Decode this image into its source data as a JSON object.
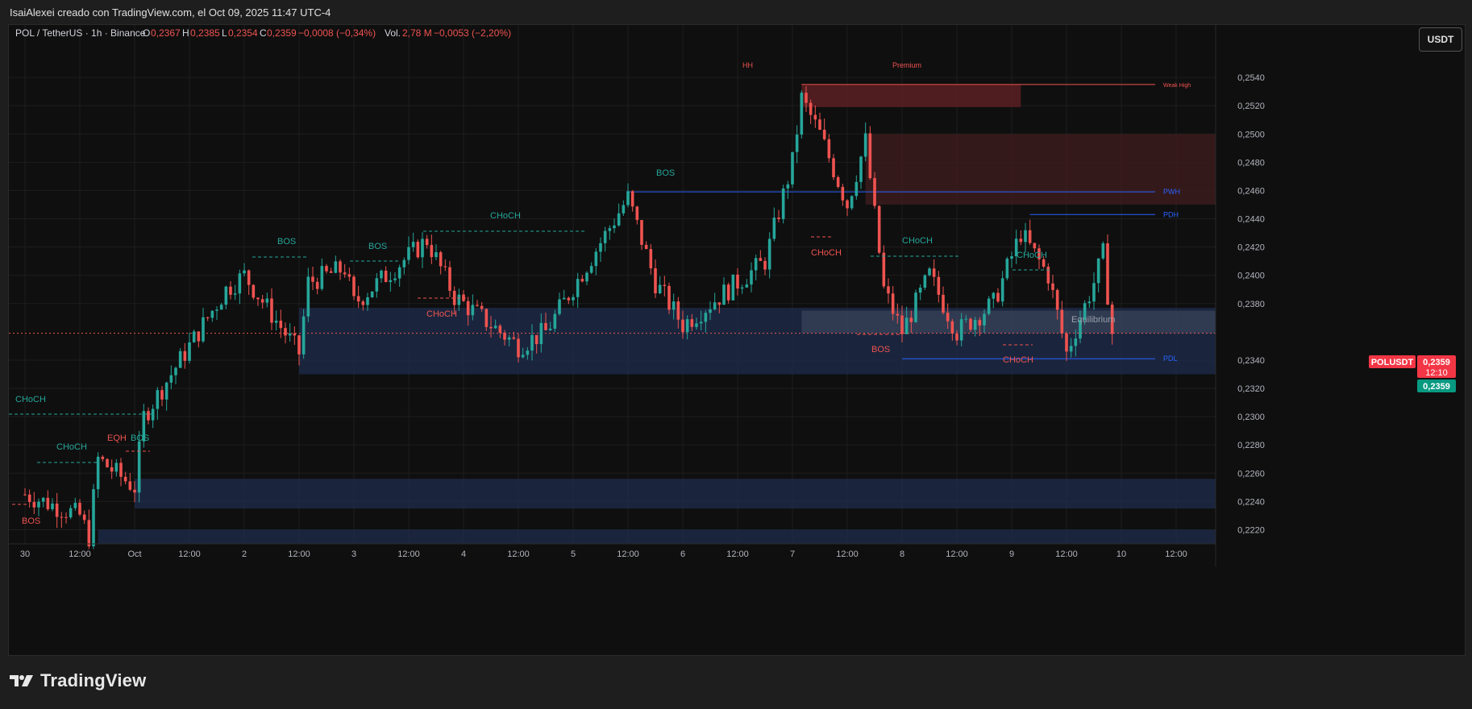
{
  "header": {
    "attribution": "IsaiAlexei creado con TradingView.com, el Oct 09, 2025 11:47 UTC-4"
  },
  "legend": {
    "symbol": "POL / TetherUS · 1h · Binance",
    "o_label": "O",
    "o_value": "0,2367",
    "h_label": "H",
    "h_value": "0,2385",
    "l_label": "L",
    "l_value": "0,2354",
    "c_label": "C",
    "c_value": "0,2359",
    "change": "−0,0008 (−0,34%)",
    "vol_label": "Vol.",
    "vol_value": "2,78 M",
    "vol_change": "−0,0053 (−2,20%)"
  },
  "currency_button": "USDT",
  "price_badges": {
    "symbol_tag": "POLUSDT",
    "last_price": "0,2359",
    "countdown": "12:10",
    "bid_price": "0,2359"
  },
  "colors": {
    "up": "#26a69a",
    "down": "#ef5350",
    "background": "#0f0f0f",
    "grid": "#1e1e1e",
    "demand_zone": "#1f2e4d",
    "premium_zone": "#5a1f22"
  },
  "chart_data": {
    "type": "candlestick",
    "title": "",
    "y_axis": {
      "side": "right",
      "ylim": [
        0.221,
        0.256
      ],
      "ticks": [
        "0,2540",
        "0,2520",
        "0,2500",
        "0,2480",
        "0,2460",
        "0,2440",
        "0,2420",
        "0,2400",
        "0,2380",
        "0,2340",
        "0,2320",
        "0,2300",
        "0,2280",
        "0,2260",
        "0,2240",
        "0,2220"
      ]
    },
    "x_axis": {
      "ticks": [
        "30",
        "12:00",
        "Oct",
        "12:00",
        "2",
        "12:00",
        "3",
        "12:00",
        "4",
        "12:00",
        "5",
        "12:00",
        "6",
        "12:00",
        "7",
        "12:00",
        "8",
        "12:00",
        "9",
        "12:00",
        "10",
        "12:00"
      ]
    },
    "grid": true,
    "current_price": 0.2359,
    "ohlc_anchor_points": [
      {
        "time": "Sep 30 00:00",
        "close": 0.2245
      },
      {
        "time": "Sep 30 12:00",
        "close": 0.223
      },
      {
        "time": "Sep 30 14:00",
        "close": 0.2215
      },
      {
        "time": "Sep 30 16:00",
        "close": 0.227
      },
      {
        "time": "Oct 1 00:00",
        "close": 0.225
      },
      {
        "time": "Oct 1 02:00",
        "close": 0.23
      },
      {
        "time": "Oct 1 12:00",
        "close": 0.235
      },
      {
        "time": "Oct 1 20:00",
        "close": 0.239
      },
      {
        "time": "Oct 2 00:00",
        "close": 0.24
      },
      {
        "time": "Oct 2 12:00",
        "close": 0.2345
      },
      {
        "time": "Oct 2 14:00",
        "close": 0.2395
      },
      {
        "time": "Oct 2 22:00",
        "close": 0.2405
      },
      {
        "time": "Oct 3 00:00",
        "close": 0.238
      },
      {
        "time": "Oct 3 16:00",
        "close": 0.2425
      },
      {
        "time": "Oct 3 22:00",
        "close": 0.2385
      },
      {
        "time": "Oct 4 12:00",
        "close": 0.235
      },
      {
        "time": "Oct 4 18:00",
        "close": 0.236
      },
      {
        "time": "Oct 5 12:00",
        "close": 0.2455
      },
      {
        "time": "Oct 5 18:00",
        "close": 0.2395
      },
      {
        "time": "Oct 6 00:00",
        "close": 0.2365
      },
      {
        "time": "Oct 6 18:00",
        "close": 0.241
      },
      {
        "time": "Oct 7 00:00",
        "close": 0.248
      },
      {
        "time": "Oct 7 02:00",
        "close": 0.2525
      },
      {
        "time": "Oct 7 06:00",
        "close": 0.25
      },
      {
        "time": "Oct 7 12:00",
        "close": 0.245
      },
      {
        "time": "Oct 7 16:00",
        "close": 0.2495
      },
      {
        "time": "Oct 7 20:00",
        "close": 0.239
      },
      {
        "time": "Oct 8 00:00",
        "close": 0.236
      },
      {
        "time": "Oct 8 06:00",
        "close": 0.24
      },
      {
        "time": "Oct 8 12:00",
        "close": 0.236
      },
      {
        "time": "Oct 8 20:00",
        "close": 0.238
      },
      {
        "time": "Oct 9 02:00",
        "close": 0.243
      },
      {
        "time": "Oct 9 08:00",
        "close": 0.24
      },
      {
        "time": "Oct 9 12:00",
        "close": 0.2345
      },
      {
        "time": "Oct 9 18:00",
        "close": 0.2395
      },
      {
        "time": "Oct 9 20:00",
        "close": 0.2415
      },
      {
        "time": "Oct 9 22:00",
        "close": 0.2359
      }
    ],
    "zones": [
      {
        "name": "demand-zone-main",
        "from_time": "Oct 2 12:00",
        "to": "right-edge",
        "low": 0.233,
        "high": 0.2377
      },
      {
        "name": "demand-zone-low",
        "from_time": "Oct 1 00:00",
        "to": "right-edge",
        "low": 0.2235,
        "high": 0.2256
      },
      {
        "name": "demand-zone-bottom",
        "from_time": "Sep 30 16:00",
        "to": "right-edge",
        "low": 0.221,
        "high": 0.222
      },
      {
        "name": "premium-zone",
        "from_time": "Oct 7 02:00",
        "to_time": "Oct 9 02:00",
        "low": 0.2519,
        "high": 0.2535
      },
      {
        "name": "supply-zone",
        "from_time": "Oct 7 16:00",
        "to": "right-edge",
        "low": 0.245,
        "high": 0.25
      },
      {
        "name": "equilibrium-zone",
        "from_time": "Oct 7 02:00",
        "to": "right-edge",
        "low": 0.2359,
        "high": 0.2375
      }
    ],
    "levels": [
      {
        "label": "Weak High",
        "value": 0.2535
      },
      {
        "label": "PWH",
        "value": 0.2459
      },
      {
        "label": "PDH",
        "value": 0.2443
      },
      {
        "label": "PDL",
        "value": 0.2341
      }
    ],
    "annotations": [
      "CHoCH",
      "CHoCH",
      "EQH",
      "BOS",
      "BOS",
      "BOS",
      "BOS",
      "CHoCH",
      "CHoCH",
      "BOS",
      "HH",
      "Premium",
      "Weak High",
      "CHoCH",
      "CHoCH",
      "BOS",
      "CHoCH",
      "CHoCH",
      "Equilibrium",
      "PWH",
      "PDH",
      "PDL"
    ]
  }
}
